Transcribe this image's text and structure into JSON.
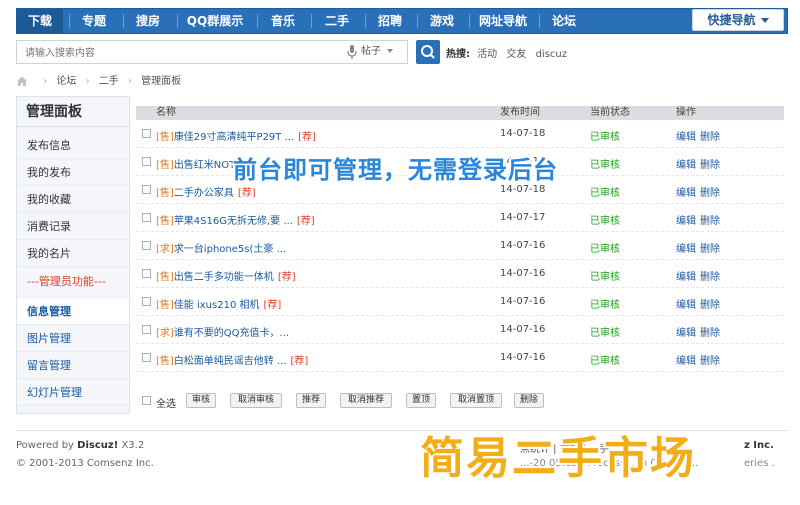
{
  "nav": {
    "items": [
      "下载",
      "专题",
      "搜房",
      "QQ群展示",
      "音乐",
      "二手",
      "招聘",
      "游戏",
      "网址导航",
      "论坛"
    ],
    "quick_nav": "快捷导航",
    "accent": "#2a70b9"
  },
  "search": {
    "placeholder": "请输入搜索内容",
    "type": "帖子",
    "hot_label": "热搜:",
    "hot_items": [
      "活动",
      "交友",
      "discuz"
    ]
  },
  "breadcrumb": {
    "items": [
      "论坛",
      "二手",
      "管理面板"
    ]
  },
  "sidebar": {
    "title": "管理面板",
    "items": [
      "发布信息",
      "我的发布",
      "我的收藏",
      "消费记录",
      "我的名片"
    ],
    "divider": "---管理员功能---",
    "admin_items": [
      "信息管理",
      "图片管理",
      "留言管理",
      "幻灯片管理"
    ]
  },
  "table": {
    "headers": [
      "名称",
      "发布时间",
      "当前状态",
      "操作"
    ],
    "rows": [
      {
        "tag": "[售]",
        "title": "康佳29寸高清纯平P29T ...",
        "badge": "[荐]",
        "date": "14-07-18",
        "status": "已审核",
        "actions": [
          "编辑",
          "删除"
        ]
      },
      {
        "tag": "[售]",
        "title": "出售红米NOTE...",
        "badge": "",
        "date": "14-07-18",
        "status": "已审核",
        "actions": [
          "编辑",
          "删除"
        ]
      },
      {
        "tag": "[售]",
        "title": "二手办公家具",
        "badge": "[荐]",
        "date": "14-07-18",
        "status": "已审核",
        "actions": [
          "编辑",
          "删除"
        ]
      },
      {
        "tag": "[售]",
        "title": "苹果4S16G无拆无修,要 ...",
        "badge": "[荐]",
        "date": "14-07-17",
        "status": "已审核",
        "actions": [
          "编辑",
          "删除"
        ]
      },
      {
        "tag": "[求]",
        "title": "求一台iphone5s(土豪 ...",
        "badge": "",
        "date": "14-07-16",
        "status": "已审核",
        "actions": [
          "编辑",
          "删除"
        ]
      },
      {
        "tag": "[售]",
        "title": "出售二手多功能一体机",
        "badge": "[荐]",
        "date": "14-07-16",
        "status": "已审核",
        "actions": [
          "编辑",
          "删除"
        ]
      },
      {
        "tag": "[售]",
        "title": "佳能 ixus210 相机",
        "badge": "[荐]",
        "date": "14-07-16",
        "status": "已审核",
        "actions": [
          "编辑",
          "删除"
        ]
      },
      {
        "tag": "[求]",
        "title": "谁有不要的QQ充值卡，...",
        "badge": "",
        "date": "14-07-16",
        "status": "已审核",
        "actions": [
          "编辑",
          "删除"
        ]
      },
      {
        "tag": "[售]",
        "title": "白松面单纯民谣吉他转 ...",
        "badge": "[荐]",
        "date": "14-07-16",
        "status": "已审核",
        "actions": [
          "编辑",
          "删除"
        ]
      }
    ]
  },
  "bulk": {
    "select_all": "全选",
    "buttons": [
      "审核",
      "取消审核",
      "推荐",
      "取消推荐",
      "置顶",
      "取消置顶",
      "删除"
    ]
  },
  "overlay": {
    "top": "前台即可管理，无需登录后台",
    "bottom": "简易二手市场"
  },
  "footer": {
    "powered_prefix": "Powered by",
    "powered_brand": "Discuz!",
    "powered_version": "X3.2",
    "copyright": "© 2001-2013 Comsenz Inc.",
    "links": "点统计 | 举报 | ...手...",
    "timeline": "...-20 05:12 , Process... in 0.1... to...",
    "company_tail": "z Inc.",
    "series_tail": "eries ."
  }
}
